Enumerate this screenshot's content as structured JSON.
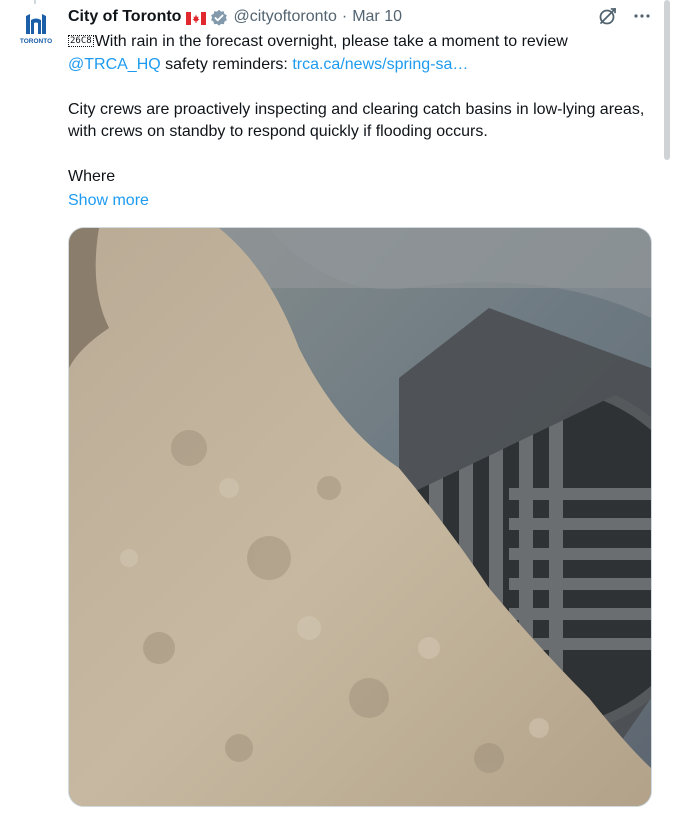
{
  "tweet": {
    "author_name": "City of Toronto",
    "handle": "@cityoftoronto",
    "separator": "·",
    "date": "Mar 10",
    "emoji_box": "26C8",
    "line1_text": "With rain in the forecast overnight, please take a moment to review",
    "mention": "@TRCA_HQ",
    "line2_text": " safety reminders: ",
    "link": "trca.ca/news/spring-sa…",
    "para2": "City crews are proactively inspecting and clearing catch basins in low-lying areas, with crews on standby to respond quickly if flooding occurs.",
    "para3": "Where",
    "show_more": "Show more",
    "avatar_logo_text": "TORONTO"
  },
  "icons": {
    "flag": "canada-flag-icon",
    "verified": "verified-badge-icon",
    "grok": "grok-icon",
    "more": "more-options-icon"
  },
  "colors": {
    "link": "#1d9bf0",
    "text": "#0f1419",
    "meta": "#536471",
    "avatar_blue": "#1a5fa8",
    "flag_red": "#e0282e"
  },
  "media": {
    "alt": "photo of snow pile beside a storm drain grate"
  }
}
